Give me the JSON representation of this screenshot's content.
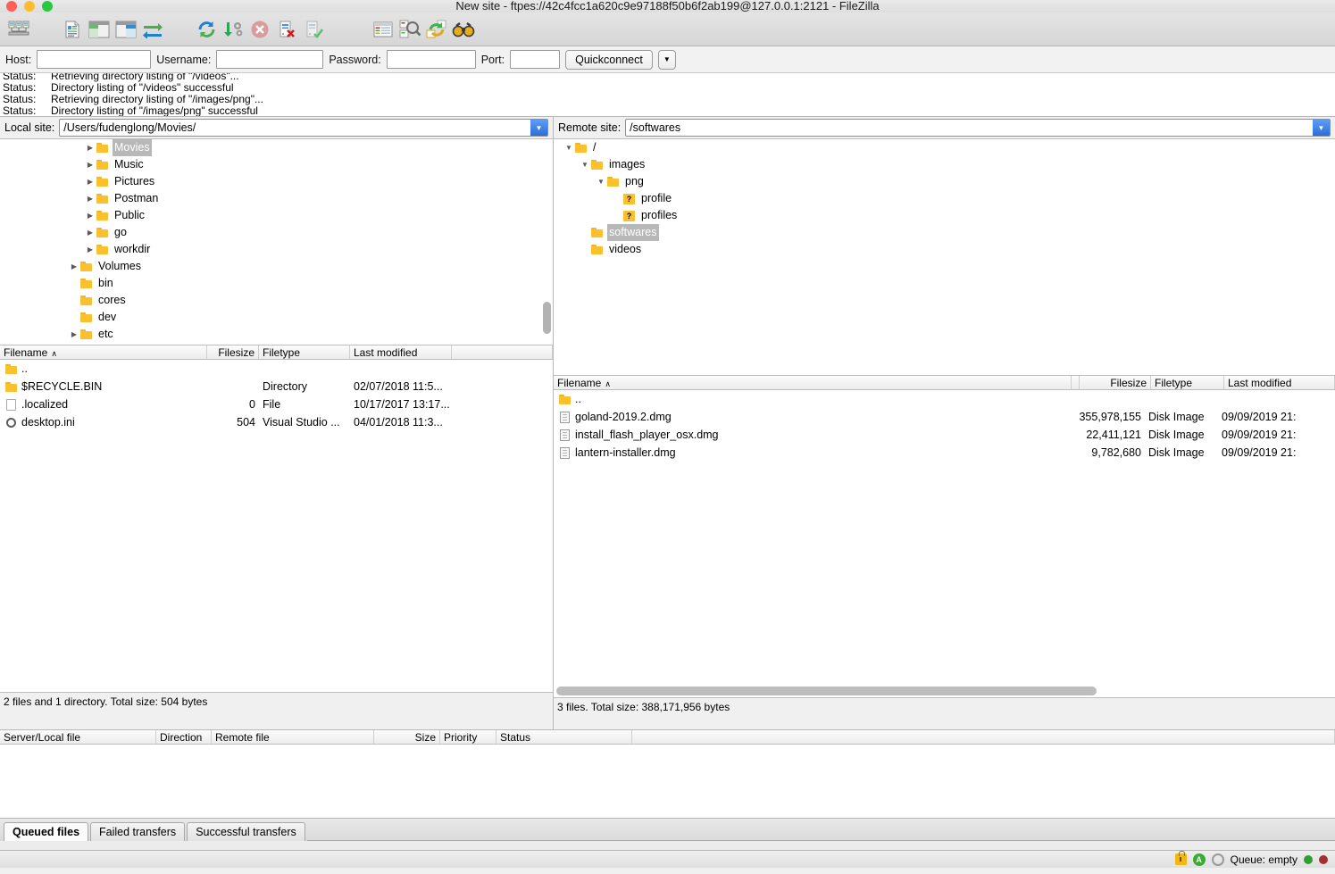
{
  "window": {
    "title": "New site - ftpes://42c4fcc1a620c9e97188f50b6f2ab199@127.0.0.1:2121 - FileZilla"
  },
  "toolbar": {
    "items": [
      {
        "name": "site-manager-icon",
        "tip": "Open the Site Manager"
      },
      {
        "name": "toggle-message-log-icon",
        "tip": "Toggle message log"
      },
      {
        "name": "toggle-local-tree-icon",
        "tip": "Toggle local directory tree"
      },
      {
        "name": "toggle-remote-tree-icon",
        "tip": "Toggle remote directory tree"
      },
      {
        "name": "toggle-transfer-queue-icon",
        "tip": "Toggle transfer queue"
      },
      {
        "name": "refresh-icon",
        "tip": "Refresh file and folder lists"
      },
      {
        "name": "process-queue-icon",
        "tip": "Process queue"
      },
      {
        "name": "cancel-icon",
        "tip": "Cancel current operation"
      },
      {
        "name": "disconnect-icon",
        "tip": "Disconnect from server"
      },
      {
        "name": "reconnect-icon",
        "tip": "Reconnect to last used server"
      },
      {
        "name": "filter-icon",
        "tip": "Open the directory listing filter dialog"
      },
      {
        "name": "compare-directories-icon",
        "tip": "Directory comparison"
      },
      {
        "name": "synchronized-browsing-icon",
        "tip": "Toggle synchronized browsing"
      },
      {
        "name": "find-files-icon",
        "tip": "Search for files recursively"
      }
    ]
  },
  "quickconnect": {
    "host_label": "Host:",
    "host_value": "",
    "username_label": "Username:",
    "username_value": "",
    "password_label": "Password:",
    "password_value": "",
    "port_label": "Port:",
    "port_value": "",
    "button_label": "Quickconnect",
    "dropdown_glyph": "▼"
  },
  "status_log": [
    {
      "kind": "Status:",
      "message": "Retrieving directory listing of \"/videos\"..."
    },
    {
      "kind": "Status:",
      "message": "Directory listing of \"/videos\" successful"
    },
    {
      "kind": "Status:",
      "message": "Retrieving directory listing of \"/images/png\"..."
    },
    {
      "kind": "Status:",
      "message": "Directory listing of \"/images/png\" successful"
    }
  ],
  "local": {
    "site_label": "Local site:",
    "site_value": "/Users/fudenglong/Movies/",
    "tree": [
      {
        "label": "Movies",
        "indent": 3,
        "twisty": "collapsed",
        "icon": "folder",
        "selected": true
      },
      {
        "label": "Music",
        "indent": 3,
        "twisty": "collapsed",
        "icon": "folder",
        "selected": false
      },
      {
        "label": "Pictures",
        "indent": 3,
        "twisty": "collapsed",
        "icon": "folder",
        "selected": false
      },
      {
        "label": "Postman",
        "indent": 3,
        "twisty": "collapsed",
        "icon": "folder",
        "selected": false
      },
      {
        "label": "Public",
        "indent": 3,
        "twisty": "collapsed",
        "icon": "folder",
        "selected": false
      },
      {
        "label": "go",
        "indent": 3,
        "twisty": "collapsed",
        "icon": "folder",
        "selected": false
      },
      {
        "label": "workdir",
        "indent": 3,
        "twisty": "collapsed",
        "icon": "folder",
        "selected": false
      },
      {
        "label": "Volumes",
        "indent": 2,
        "twisty": "collapsed",
        "icon": "folder",
        "selected": false
      },
      {
        "label": "bin",
        "indent": 2,
        "twisty": "none",
        "icon": "folder",
        "selected": false
      },
      {
        "label": "cores",
        "indent": 2,
        "twisty": "none",
        "icon": "folder",
        "selected": false
      },
      {
        "label": "dev",
        "indent": 2,
        "twisty": "none",
        "icon": "folder",
        "selected": false
      },
      {
        "label": "etc",
        "indent": 2,
        "twisty": "collapsed",
        "icon": "folder",
        "selected": false
      }
    ],
    "columns": [
      {
        "label": "Filename",
        "sorted": true,
        "sort_glyph": "∧"
      },
      {
        "label": "Filesize"
      },
      {
        "label": "Filetype"
      },
      {
        "label": "Last modified"
      },
      {
        "label": ""
      }
    ],
    "files": [
      {
        "icon": "folder",
        "name": "..",
        "size": "",
        "type": "",
        "modified": ""
      },
      {
        "icon": "folder",
        "name": "$RECYCLE.BIN",
        "size": "",
        "type": "Directory",
        "modified": "02/07/2018 11:5..."
      },
      {
        "icon": "file",
        "name": ".localized",
        "size": "0",
        "type": "File",
        "modified": "10/17/2017 13:17..."
      },
      {
        "icon": "gear",
        "name": "desktop.ini",
        "size": "504",
        "type": "Visual Studio ...",
        "modified": "04/01/2018 11:3..."
      }
    ],
    "status": "2 files and 1 directory. Total size: 504 bytes"
  },
  "remote": {
    "site_label": "Remote site:",
    "site_value": "/softwares",
    "tree": [
      {
        "label": "/",
        "indent": 0,
        "twisty": "expanded",
        "icon": "folder",
        "selected": false
      },
      {
        "label": "images",
        "indent": 1,
        "twisty": "expanded",
        "icon": "folder",
        "selected": false
      },
      {
        "label": "png",
        "indent": 2,
        "twisty": "expanded",
        "icon": "folder",
        "selected": false
      },
      {
        "label": "profile",
        "indent": 3,
        "twisty": "none",
        "icon": "question",
        "selected": false
      },
      {
        "label": "profiles",
        "indent": 3,
        "twisty": "none",
        "icon": "question",
        "selected": false
      },
      {
        "label": "softwares",
        "indent": 1,
        "twisty": "none",
        "icon": "folder",
        "selected": true
      },
      {
        "label": "videos",
        "indent": 1,
        "twisty": "none",
        "icon": "folder",
        "selected": false
      }
    ],
    "columns": [
      {
        "label": "Filename",
        "sorted": true,
        "sort_glyph": "∧"
      },
      {
        "label": ""
      },
      {
        "label": "Filesize"
      },
      {
        "label": "Filetype"
      },
      {
        "label": "Last modified"
      }
    ],
    "files": [
      {
        "icon": "folder",
        "name": "..",
        "size": "",
        "type": "",
        "modified": ""
      },
      {
        "icon": "doc",
        "name": "goland-2019.2.dmg",
        "size": "355,978,155",
        "type": "Disk Image",
        "modified": "09/09/2019 21:"
      },
      {
        "icon": "doc",
        "name": "install_flash_player_osx.dmg",
        "size": "22,411,121",
        "type": "Disk Image",
        "modified": "09/09/2019 21:"
      },
      {
        "icon": "doc",
        "name": "lantern-installer.dmg",
        "size": "9,782,680",
        "type": "Disk Image",
        "modified": "09/09/2019 21:"
      }
    ],
    "status": "3 files. Total size: 388,171,956 bytes"
  },
  "queue": {
    "columns": [
      "Server/Local file",
      "Direction",
      "Remote file",
      "Size",
      "Priority",
      "Status",
      ""
    ],
    "rows": [],
    "tabs": [
      {
        "label": "Queued files",
        "active": true
      },
      {
        "label": "Failed transfers",
        "active": false
      },
      {
        "label": "Successful transfers",
        "active": false
      }
    ]
  },
  "bottom": {
    "queue_status": "Queue: empty",
    "icons": [
      "lock-icon",
      "auth-icon",
      "speed-icon",
      "green-status-dot",
      "red-status-dot"
    ]
  }
}
